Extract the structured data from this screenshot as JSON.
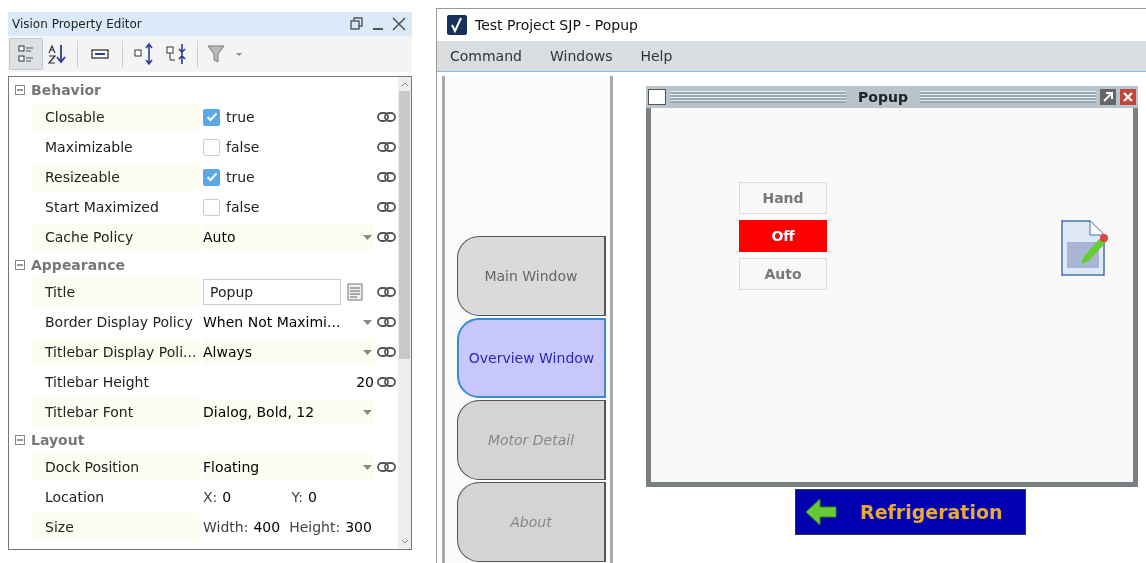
{
  "property_editor": {
    "title": "Vision Property Editor",
    "categories": [
      {
        "name": "Behavior",
        "expanded": true,
        "properties": [
          {
            "kind": "checkbox",
            "label": "Closable",
            "checked": true,
            "value": "true",
            "bindable": true
          },
          {
            "kind": "checkbox",
            "label": "Maximizable",
            "checked": false,
            "value": "false",
            "bindable": true
          },
          {
            "kind": "checkbox",
            "label": "Resizeable",
            "checked": true,
            "value": "true",
            "bindable": true
          },
          {
            "kind": "checkbox",
            "label": "Start Maximized",
            "checked": false,
            "value": "false",
            "bindable": true
          },
          {
            "kind": "dropdown",
            "label": "Cache Policy",
            "value": "Auto",
            "bindable": true
          }
        ]
      },
      {
        "name": "Appearance",
        "expanded": true,
        "properties": [
          {
            "kind": "text",
            "label": "Title",
            "value": "Popup",
            "bindable": true
          },
          {
            "kind": "dropdown",
            "label": "Border Display Policy",
            "value": "When Not Maximi...",
            "bindable": true
          },
          {
            "kind": "dropdown",
            "label": "Titlebar Display Poli...",
            "value": "Always",
            "bindable": true
          },
          {
            "kind": "number",
            "label": "Titlebar Height",
            "value": "20",
            "bindable": true
          },
          {
            "kind": "dropdown",
            "label": "Titlebar Font",
            "value": "Dialog, Bold, 12",
            "bindable": false
          }
        ]
      },
      {
        "name": "Layout",
        "expanded": true,
        "properties": [
          {
            "kind": "dropdown",
            "label": "Dock Position",
            "value": "Floating",
            "bindable": true
          },
          {
            "kind": "pair",
            "label": "Location",
            "bindable": false,
            "fields": [
              {
                "label": "X:",
                "value": "0"
              },
              {
                "label": "Y:",
                "value": "0"
              }
            ]
          },
          {
            "kind": "pair",
            "label": "Size",
            "bindable": false,
            "fields": [
              {
                "label": "Width:",
                "value": "400"
              },
              {
                "label": "Height:",
                "value": "300"
              }
            ]
          }
        ]
      }
    ]
  },
  "app": {
    "title": "Test Project SJP - Popup",
    "menu": [
      "Command",
      "Windows",
      "Help"
    ],
    "tabs": [
      {
        "label": "Main Window",
        "selected": false,
        "disabled": false
      },
      {
        "label": "Overview Window",
        "selected": true,
        "disabled": false
      },
      {
        "label": "Motor Detail",
        "selected": false,
        "disabled": true
      },
      {
        "label": "About",
        "selected": false,
        "disabled": true
      }
    ],
    "popup": {
      "title": "Popup",
      "buttons": [
        {
          "label": "Hand",
          "active": false
        },
        {
          "label": "Off",
          "active": true
        },
        {
          "label": "Auto",
          "active": false
        }
      ]
    },
    "nav_button": {
      "label": "Refrigeration"
    }
  }
}
